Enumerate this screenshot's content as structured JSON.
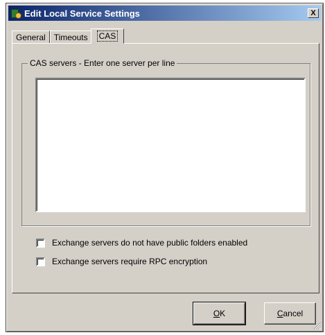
{
  "window": {
    "title": "Edit Local Service Settings",
    "close_glyph": "X"
  },
  "tabs": [
    {
      "label": "General",
      "active": false
    },
    {
      "label": "Timeouts",
      "active": false
    },
    {
      "label": "CAS",
      "active": true
    }
  ],
  "cas": {
    "group_label": "CAS servers - Enter one server per line",
    "servers_value": ""
  },
  "options": [
    {
      "label": "Exchange servers do not have public folders enabled",
      "checked": false
    },
    {
      "label": "Exchange servers require RPC encryption",
      "checked": false
    }
  ],
  "buttons": {
    "ok": {
      "mnemonic": "O",
      "rest": "K"
    },
    "cancel": {
      "mnemonic": "C",
      "rest": "ancel"
    }
  },
  "colors": {
    "face": "#d4d0c8",
    "title_start": "#0a246a",
    "title_end": "#a6caf0"
  },
  "icons": {
    "app": "exchange-app-icon",
    "close": "close-icon",
    "grip": "resize-grip-icon"
  }
}
